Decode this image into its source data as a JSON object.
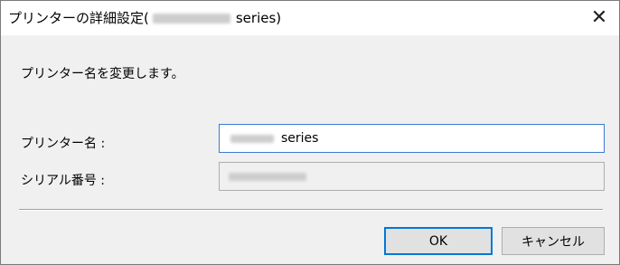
{
  "dialog": {
    "title_prefix": "プリンターの詳細設定(",
    "title_suffix": "series)",
    "close_glyph": "✕",
    "instruction": "プリンター名を変更します。",
    "printer_name_label": "プリンター名 :",
    "printer_name_value": "series",
    "serial_label": "シリアル番号 :",
    "ok_label": "OK",
    "cancel_label": "キャンセル"
  },
  "colors": {
    "focus_border": "#3a7bd5",
    "default_button_border": "#0078d7",
    "dialog_background": "#f0f0f0"
  }
}
